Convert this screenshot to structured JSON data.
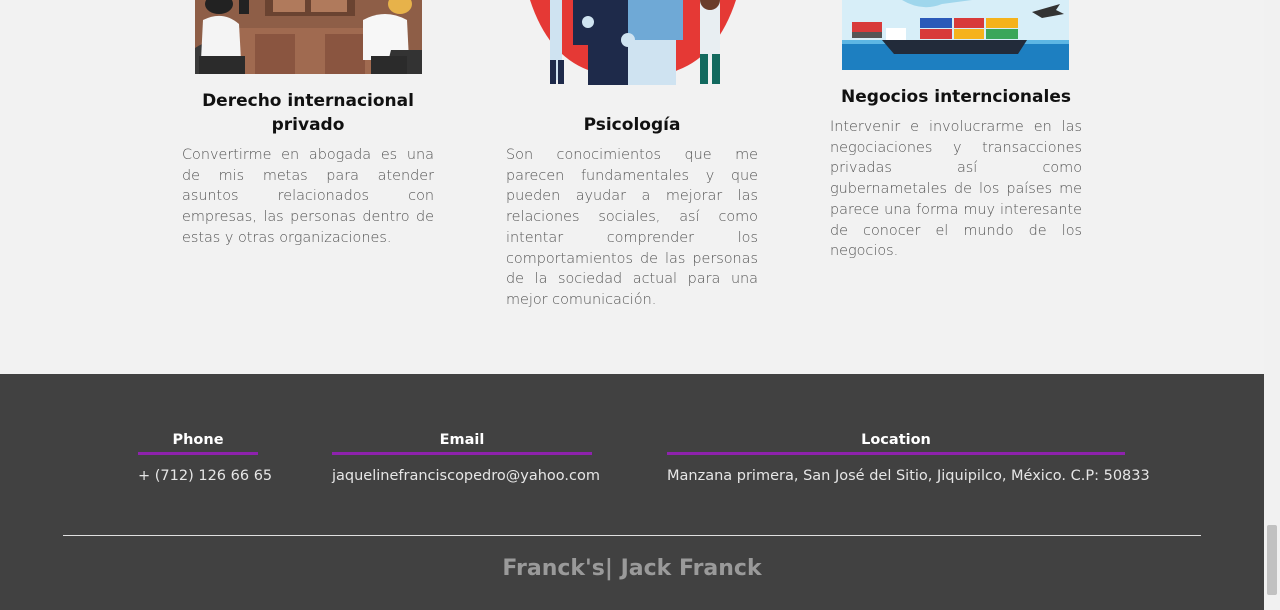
{
  "cards": [
    {
      "title_line1": "Derecho internacional",
      "title_line2": "privado",
      "text": "Convertirme en abogada es una de mis metas para atender asuntos relacionados con empresas, las personas dentro de estas y otras organizaciones."
    },
    {
      "title_line1": "Psicología",
      "text": "Son conocimientos que me parecen fundamentales y que pueden ayudar a mejorar las relaciones sociales, así como intentar comprender los comportamientos de las personas de la sociedad actual para una mejor comunicación."
    },
    {
      "title_line1": "Negocios interncionales",
      "text": "Intervenir e involucrarme en las negociaciones y transacciones privadas así como gubernametales de los países me parece una forma muy interesante de conocer el mundo de los negocios."
    }
  ],
  "footer": {
    "phone": {
      "title": "Phone",
      "value": "+ (712) 126 66 65"
    },
    "email": {
      "title": "Email",
      "value": "jaquelinefranciscopedro@yahoo.com"
    },
    "location": {
      "title": "Location",
      "value": "Manzana primera, San José del Sitio, Jiquipilco, México. C.P: 50833"
    },
    "brand": "Franck's| Jack Franck"
  },
  "colors": {
    "accent": "#8e22ad",
    "footer_bg": "#414141",
    "page_bg": "#f2f2f2"
  }
}
